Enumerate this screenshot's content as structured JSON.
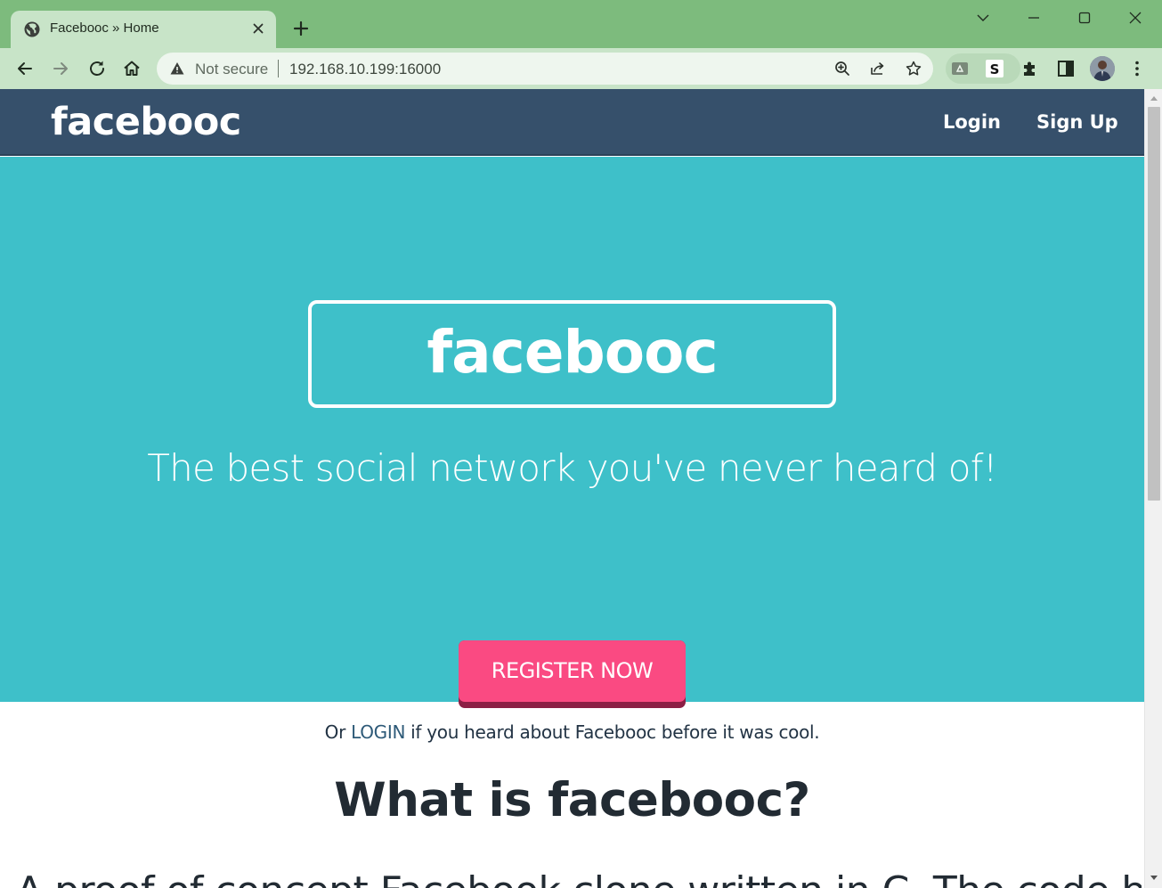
{
  "browser": {
    "tab_title": "Facebooc » Home",
    "security_label": "Not secure",
    "url": "192.168.10.199:16000",
    "icons": {
      "tab": "globe-icon",
      "close": "close-icon",
      "new_tab": "plus-icon",
      "window": [
        "chevron-down-icon",
        "minimize-icon",
        "maximize-icon",
        "close-icon"
      ],
      "nav": [
        "back-icon",
        "forward-icon",
        "reload-icon",
        "home-icon"
      ],
      "omnibox": [
        "warning-icon",
        "zoom-icon",
        "share-icon",
        "star-icon"
      ],
      "toolbar": [
        "drive-extension-icon",
        "s-extension-icon",
        "puzzle-icon",
        "side-panel-icon",
        "avatar",
        "menu-icon"
      ]
    },
    "colors": {
      "frame": "#7dbb7d",
      "toolbar": "#c8e4c8"
    }
  },
  "site": {
    "brand": "facebooc",
    "nav": {
      "login": "Login",
      "signup": "Sign Up"
    },
    "hero": {
      "logo": "facebooc",
      "tagline": "The best social network you've never heard of!",
      "register_button": "REGISTER NOW",
      "or_prefix": "Or ",
      "or_login_link": "LOGIN",
      "or_suffix": " if you heard about Facebooc before it was cool."
    },
    "about": {
      "title": "What is facebooc?",
      "body": "A proof of concept Facebook clone written in C. The code base can be used"
    },
    "colors": {
      "navbar": "#36506b",
      "hero": "#3ec0c9",
      "button": "#fa4a82",
      "button_shadow": "#8c1f45",
      "text_dark": "#222b33"
    }
  }
}
